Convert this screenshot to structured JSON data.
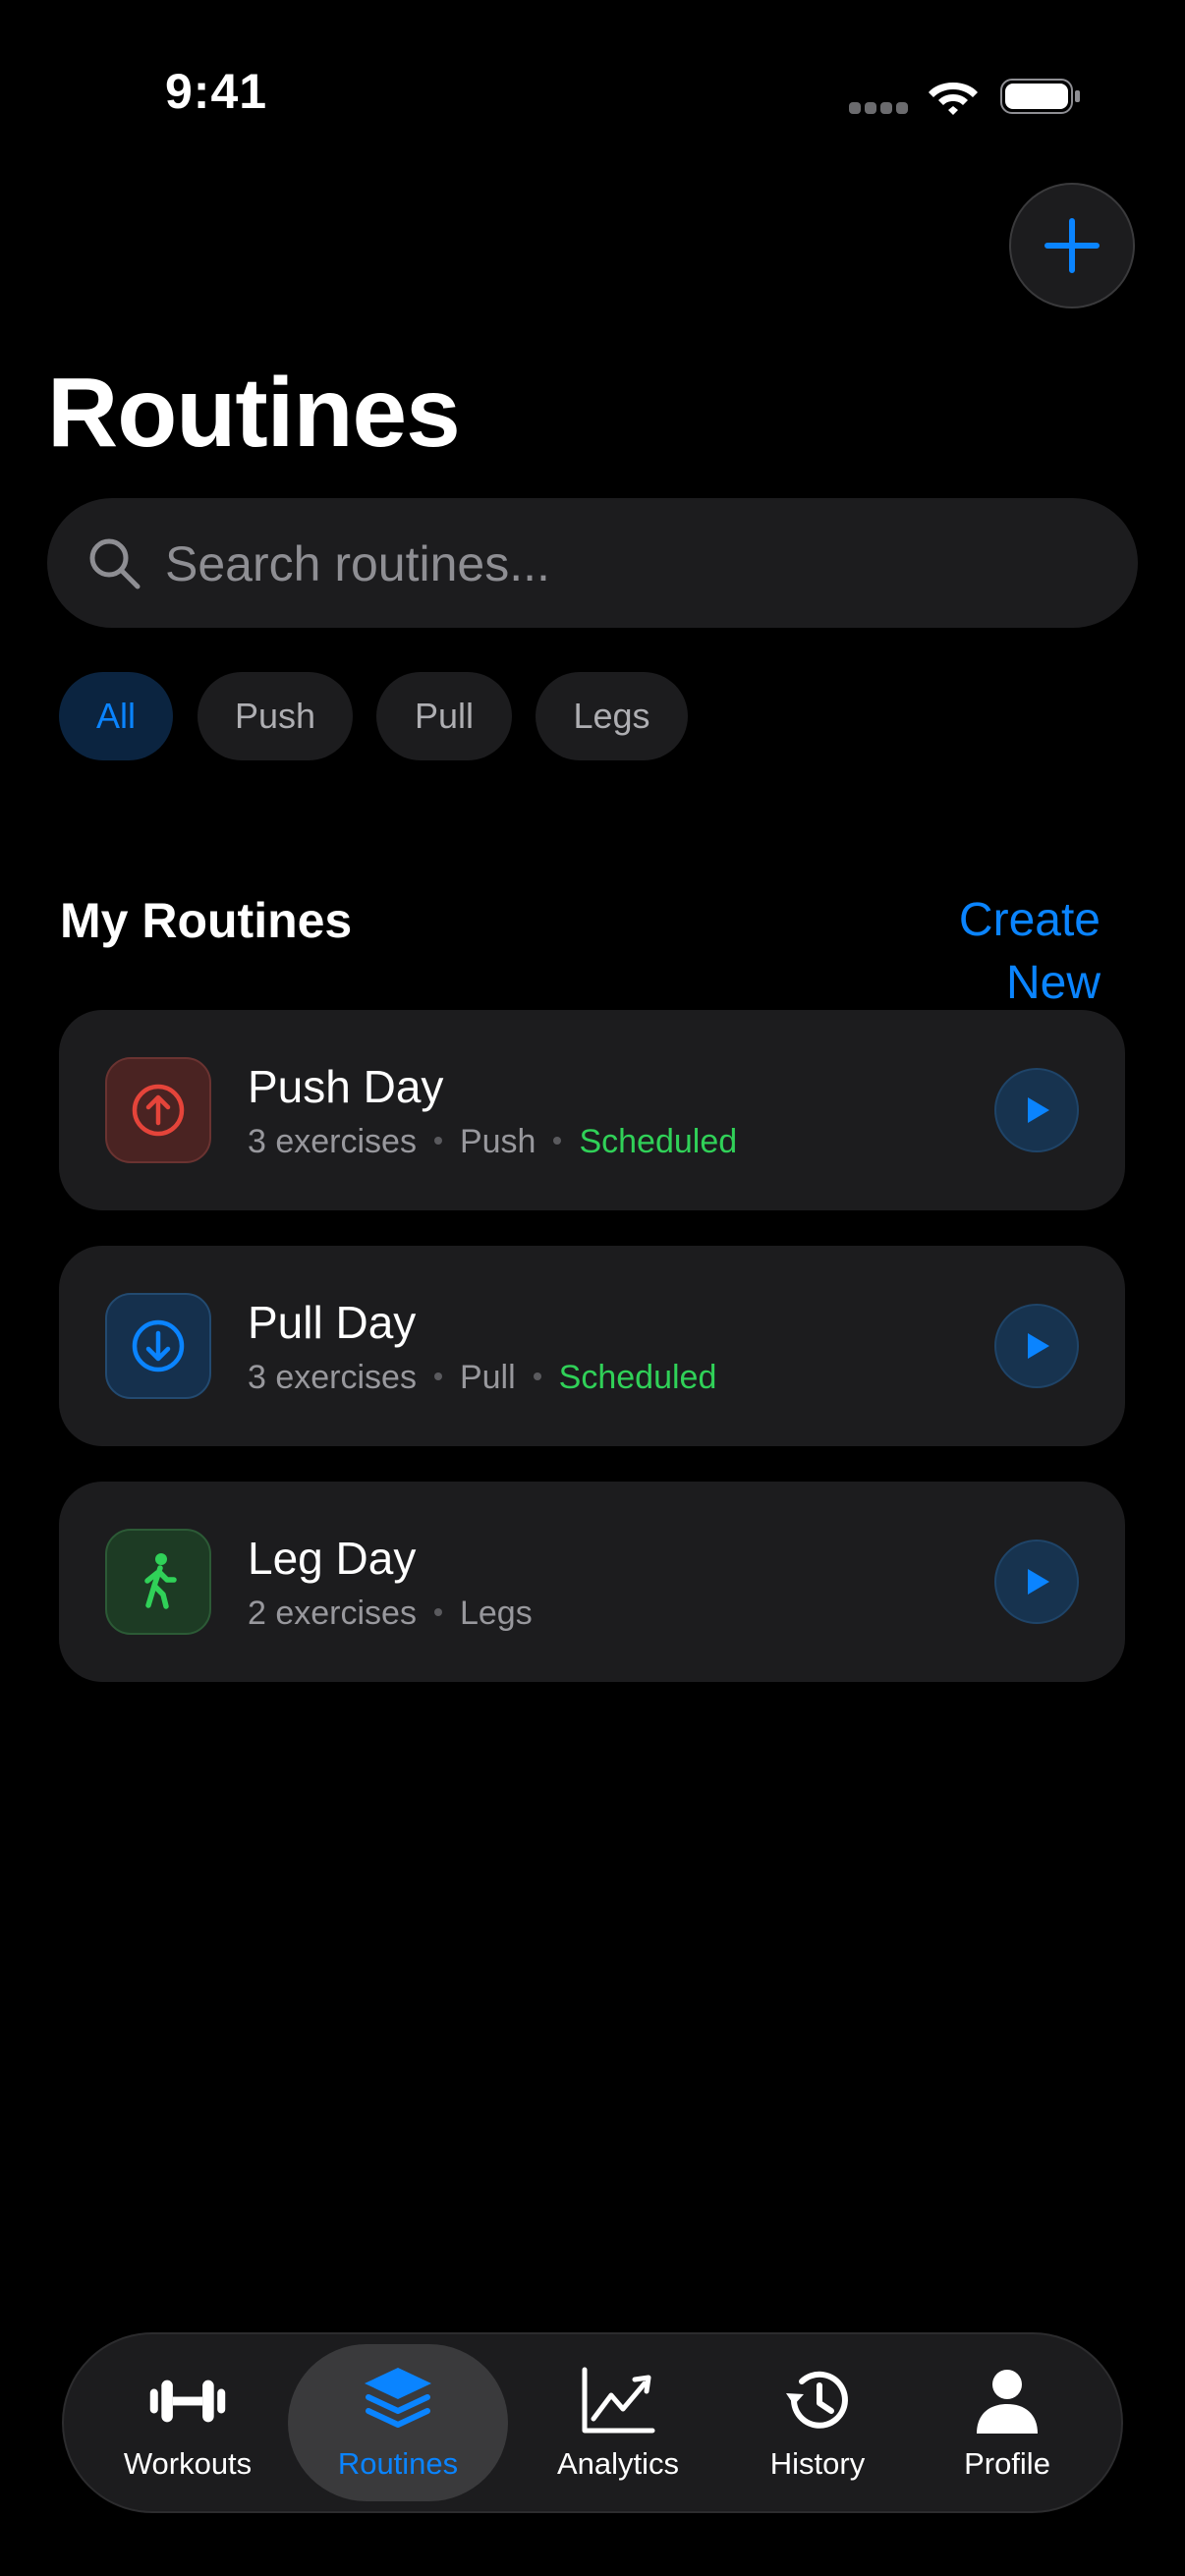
{
  "status_bar": {
    "time": "9:41"
  },
  "header": {
    "title": "Routines"
  },
  "search": {
    "placeholder": "Search routines..."
  },
  "filters": [
    {
      "label": "All",
      "active": true
    },
    {
      "label": "Push",
      "active": false
    },
    {
      "label": "Pull",
      "active": false
    },
    {
      "label": "Legs",
      "active": false
    }
  ],
  "section": {
    "title": "My Routines",
    "action": "Create New"
  },
  "routines": [
    {
      "name": "Push Day",
      "exercises": "3 exercises",
      "category": "Push",
      "status": "Scheduled",
      "icon": "arrow-up-circle-icon",
      "color": "#e5443a"
    },
    {
      "name": "Pull Day",
      "exercises": "3 exercises",
      "category": "Pull",
      "status": "Scheduled",
      "icon": "arrow-down-circle-icon",
      "color": "#0a84ff"
    },
    {
      "name": "Leg Day",
      "exercises": "2 exercises",
      "category": "Legs",
      "status": "",
      "icon": "walking-figure-icon",
      "color": "#30d158"
    }
  ],
  "tabs": [
    {
      "label": "Workouts",
      "icon": "dumbbell-icon",
      "active": false
    },
    {
      "label": "Routines",
      "icon": "stack-layers-icon",
      "active": true
    },
    {
      "label": "Analytics",
      "icon": "chart-trend-icon",
      "active": false
    },
    {
      "label": "History",
      "icon": "clock-history-icon",
      "active": false
    },
    {
      "label": "Profile",
      "icon": "person-icon",
      "active": false
    }
  ],
  "colors": {
    "accent": "#0a84ff",
    "success": "#30d158",
    "danger": "#e5443a",
    "card": "#1c1c1e",
    "background": "#000000"
  }
}
